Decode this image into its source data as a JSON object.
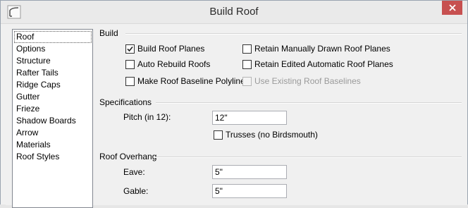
{
  "window": {
    "title": "Build Roof",
    "close_icon": "close-icon",
    "app_icon": "roof-app-icon",
    "close_color": "#c75050"
  },
  "nav": {
    "items": [
      {
        "label": "Roof",
        "selected": true
      },
      {
        "label": "Options"
      },
      {
        "label": "Structure"
      },
      {
        "label": "Rafter Tails"
      },
      {
        "label": "Ridge Caps"
      },
      {
        "label": "Gutter"
      },
      {
        "label": "Frieze"
      },
      {
        "label": "Shadow Boards"
      },
      {
        "label": "Arrow"
      },
      {
        "label": "Materials"
      },
      {
        "label": "Roof Styles"
      }
    ]
  },
  "build": {
    "label": "Build",
    "build_roof_planes": {
      "label": "Build Roof Planes",
      "checked": true
    },
    "auto_rebuild_roofs": {
      "label": "Auto Rebuild Roofs",
      "checked": false
    },
    "make_roof_baseline_polylines": {
      "label": "Make Roof Baseline Polylines",
      "checked": false
    },
    "retain_manually_drawn": {
      "label": "Retain Manually Drawn Roof Planes",
      "checked": false
    },
    "retain_edited_automatic": {
      "label": "Retain Edited Automatic Roof Planes",
      "checked": false
    },
    "use_existing_baselines": {
      "label": "Use Existing Roof Baselines",
      "checked": false,
      "disabled": true
    }
  },
  "specifications": {
    "label": "Specifications",
    "pitch_label": "Pitch (in 12):",
    "pitch_value": "12\"",
    "trusses": {
      "label": "Trusses (no Birdsmouth)",
      "checked": false
    }
  },
  "overhang": {
    "label": "Roof Overhang",
    "eave_label": "Eave:",
    "eave_value": "5\"",
    "gable_label": "Gable:",
    "gable_value": "5\""
  }
}
